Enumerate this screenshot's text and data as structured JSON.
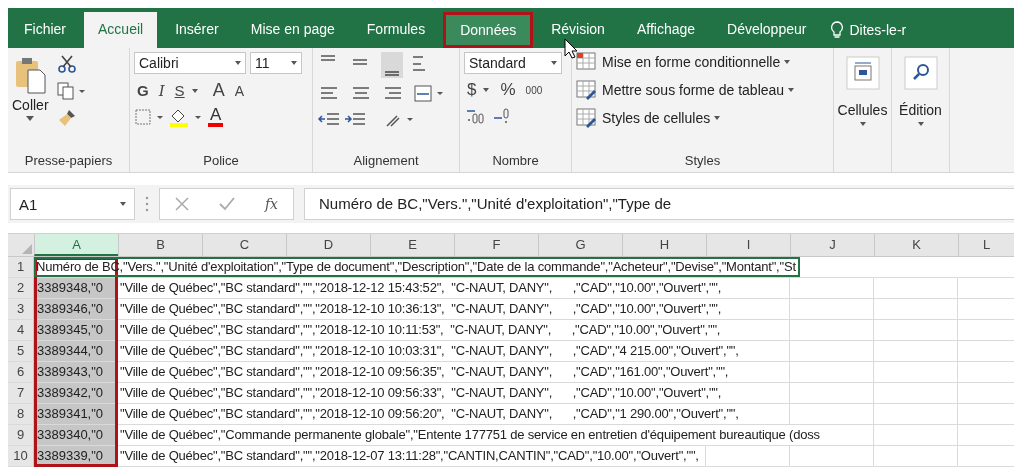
{
  "ribbon_tabs": [
    {
      "label": "Fichier",
      "selected": false,
      "highlighted": false
    },
    {
      "label": "Accueil",
      "selected": true,
      "highlighted": false
    },
    {
      "label": "Insérer",
      "selected": false,
      "highlighted": false
    },
    {
      "label": "Mise en page",
      "selected": false,
      "highlighted": false
    },
    {
      "label": "Formules",
      "selected": false,
      "highlighted": false
    },
    {
      "label": "Données",
      "selected": false,
      "highlighted": true
    },
    {
      "label": "Révision",
      "selected": false,
      "highlighted": false
    },
    {
      "label": "Affichage",
      "selected": false,
      "highlighted": false
    },
    {
      "label": "Développeur",
      "selected": false,
      "highlighted": false
    }
  ],
  "tell_me": "Dites-le-r",
  "clipboard": {
    "paste_label": "Coller",
    "group_label": "Presse-papiers"
  },
  "font": {
    "family": "Calibri",
    "size": "11",
    "bold": "G",
    "italic": "I",
    "underline": "S",
    "grow": "A",
    "shrink": "A",
    "color_letter": "A",
    "group_label": "Police"
  },
  "alignment": {
    "group_label": "Alignement"
  },
  "number": {
    "format": "Standard",
    "currency": "$",
    "percent": "%",
    "thousands": "000",
    "group_label": "Nombre"
  },
  "styles": {
    "items": [
      "Mise en forme conditionnelle",
      "Mettre sous forme de tableau",
      "Styles de cellules"
    ],
    "group_label": "Styles"
  },
  "cells": {
    "label": "Cellules"
  },
  "editing": {
    "label": "Édition"
  },
  "formula_bar": {
    "name_box": "A1",
    "function_label": "fx",
    "content": "Numéro de BC,\"Vers.\",\"Unité d'exploitation\",\"Type de"
  },
  "columns": [
    {
      "label": "A",
      "selected": true,
      "highlighted": true
    },
    {
      "label": "B",
      "selected": false,
      "highlighted": false
    },
    {
      "label": "C",
      "selected": false,
      "highlighted": false
    },
    {
      "label": "D",
      "selected": false,
      "highlighted": false
    },
    {
      "label": "E",
      "selected": false,
      "highlighted": false
    },
    {
      "label": "F",
      "selected": false,
      "highlighted": false
    },
    {
      "label": "G",
      "selected": false,
      "highlighted": false
    },
    {
      "label": "H",
      "selected": false,
      "highlighted": false
    },
    {
      "label": "I",
      "selected": false,
      "highlighted": false
    },
    {
      "label": "J",
      "selected": false,
      "highlighted": false
    },
    {
      "label": "K",
      "selected": false,
      "highlighted": false
    },
    {
      "label": "L",
      "selected": false,
      "highlighted": false
    }
  ],
  "rows": [
    {
      "number": "1",
      "active": true,
      "text": "Numéro de BC,\"Vers.\",\"Unité d'exploitation\",\"Type de document\",\"Description\",\"Date de la commande\",\"Acheteur\",\"Devise\",\"Montant\",\"St"
    },
    {
      "number": "2",
      "active": false,
      "a": "3389348,\"0",
      "text": "\"Ville de Québec\",\"BC standard\",\"\",\"2018-12-12 15:43:52\",  \"C-NAUT, DANY\",      ,\"CAD\",\"10.00\",\"Ouvert\",\"\","
    },
    {
      "number": "3",
      "active": false,
      "a": "3389346,\"0",
      "text": "\"Ville de Québec\",\"BC standard\",\"\",\"2018-12-10 10:36:13\",  \"C-NAUT, DANY\",      ,\"CAD\",\"10.00\",\"Ouvert\",\"\","
    },
    {
      "number": "4",
      "active": false,
      "a": "3389345,\"0",
      "text": "\"Ville de Québec\",\"BC standard\",\"\",\"2018-12-10 10:11:53\",  \"C-NAUT, DANY\",      ,\"CAD\",\"10.00\",\"Ouvert\",\"\","
    },
    {
      "number": "5",
      "active": false,
      "a": "3389344,\"0",
      "text": "\"Ville de Québec\",\"BC standard\",\"\",\"2018-12-10 10:03:31\",  \"C-NAUT, DANY\",      ,\"CAD\",\"4 215.00\",\"Ouvert\",\"\","
    },
    {
      "number": "6",
      "active": false,
      "a": "3389343,\"0",
      "text": "\"Ville de Québec\",\"BC standard\",\"\",\"2018-12-10 09:56:35\",  \"C-NAUT, DANY\",      ,\"CAD\",\"161.00\",\"Ouvert\",\"\","
    },
    {
      "number": "7",
      "active": false,
      "a": "3389342,\"0",
      "text": "\"Ville de Québec\",\"BC standard\",\"\",\"2018-12-10 09:56:33\",  \"C-NAUT, DANY\",      ,\"CAD\",\"10.00\",\"Ouvert\",\"\","
    },
    {
      "number": "8",
      "active": false,
      "a": "3389341,\"0",
      "text": "\"Ville de Québec\",\"BC standard\",\"\",\"2018-12-10 09:56:20\",  \"C-NAUT, DANY\",      ,\"CAD\",\"1 290.00\",\"Ouvert\",\"\","
    },
    {
      "number": "9",
      "active": false,
      "a": "3389340,\"0",
      "text": "\"Ville de Québec\",\"Commande permanente globale\",\"Entente 177751 de service en entretien d'équipement bureautique (doss"
    },
    {
      "number": "10",
      "active": false,
      "a": "3389339,\"0",
      "text": "\"Ville de Québec\",\"BC standard\",\"\",\"2018-12-07 13:11:28\",\"CANTIN,CANTIN\",\"CAD\",\"10.00\",\"Ouvert\",\"\","
    }
  ]
}
